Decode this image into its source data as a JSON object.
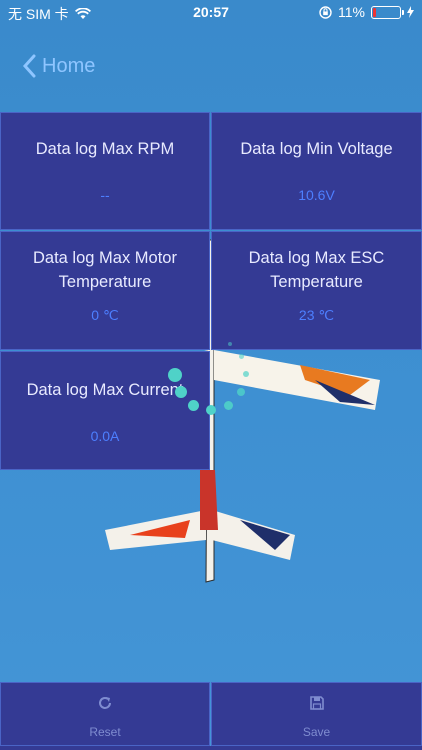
{
  "status_bar": {
    "carrier": "无 SIM 卡",
    "time": "20:57",
    "battery_percent": "11%",
    "battery_level": 0.11
  },
  "nav": {
    "back_label": "Home"
  },
  "cells": [
    {
      "label": "Data log Max RPM",
      "value": "--"
    },
    {
      "label": "Data log Min Voltage",
      "value": "10.6V"
    },
    {
      "label": "Data log Max Motor Temperature",
      "value": "0 ℃"
    },
    {
      "label": "Data log Max ESC Temperature",
      "value": "23 ℃"
    },
    {
      "label": "Data log Max Current",
      "value": "0.0A"
    }
  ],
  "buttons": {
    "reset_label": "Reset",
    "save_label": "Save"
  },
  "colors": {
    "cell_bg": "#343a94",
    "cell_border": "#4a64c6",
    "value_text": "#4d7fff",
    "back_text": "#8ec5ff",
    "spinner": "#4fd2c8"
  }
}
